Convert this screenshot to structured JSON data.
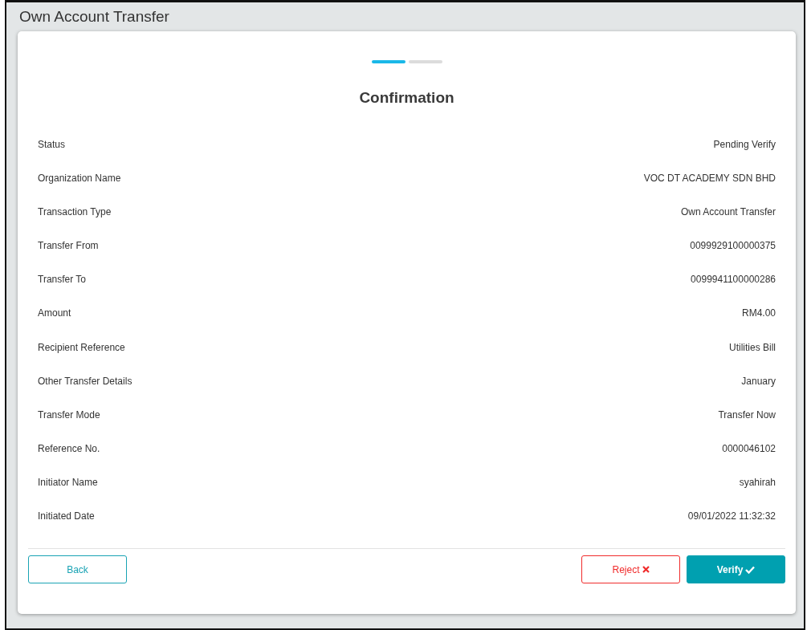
{
  "page_title": "Own Account Transfer",
  "steps": [
    {
      "selected": true
    },
    {
      "selected": false
    }
  ],
  "heading": "Confirmation",
  "details": [
    {
      "label": "Status",
      "value": "Pending Verify"
    },
    {
      "label": "Organization Name",
      "value": "VOC DT ACADEMY SDN BHD"
    },
    {
      "label": "Transaction Type",
      "value": "Own Account Transfer"
    },
    {
      "label": "Transfer From",
      "value": "0099929100000375"
    },
    {
      "label": "Transfer To",
      "value": "0099941100000286"
    },
    {
      "label": "Amount",
      "value": "RM4.00"
    },
    {
      "label": "Recipient Reference",
      "value": "Utilities Bill"
    },
    {
      "label": "Other Transfer Details",
      "value": "January"
    },
    {
      "label": "Transfer Mode",
      "value": "Transfer Now"
    },
    {
      "label": "Reference No.",
      "value": "0000046102"
    },
    {
      "label": "Initiator Name",
      "value": "syahirah"
    },
    {
      "label": "Initiated Date",
      "value": "09/01/2022 11:32:32"
    }
  ],
  "buttons": [
    {
      "kind": "back",
      "label": "Back"
    },
    {
      "kind": "reject",
      "label": "Reject"
    },
    {
      "kind": "verify",
      "label": "Verify"
    }
  ]
}
